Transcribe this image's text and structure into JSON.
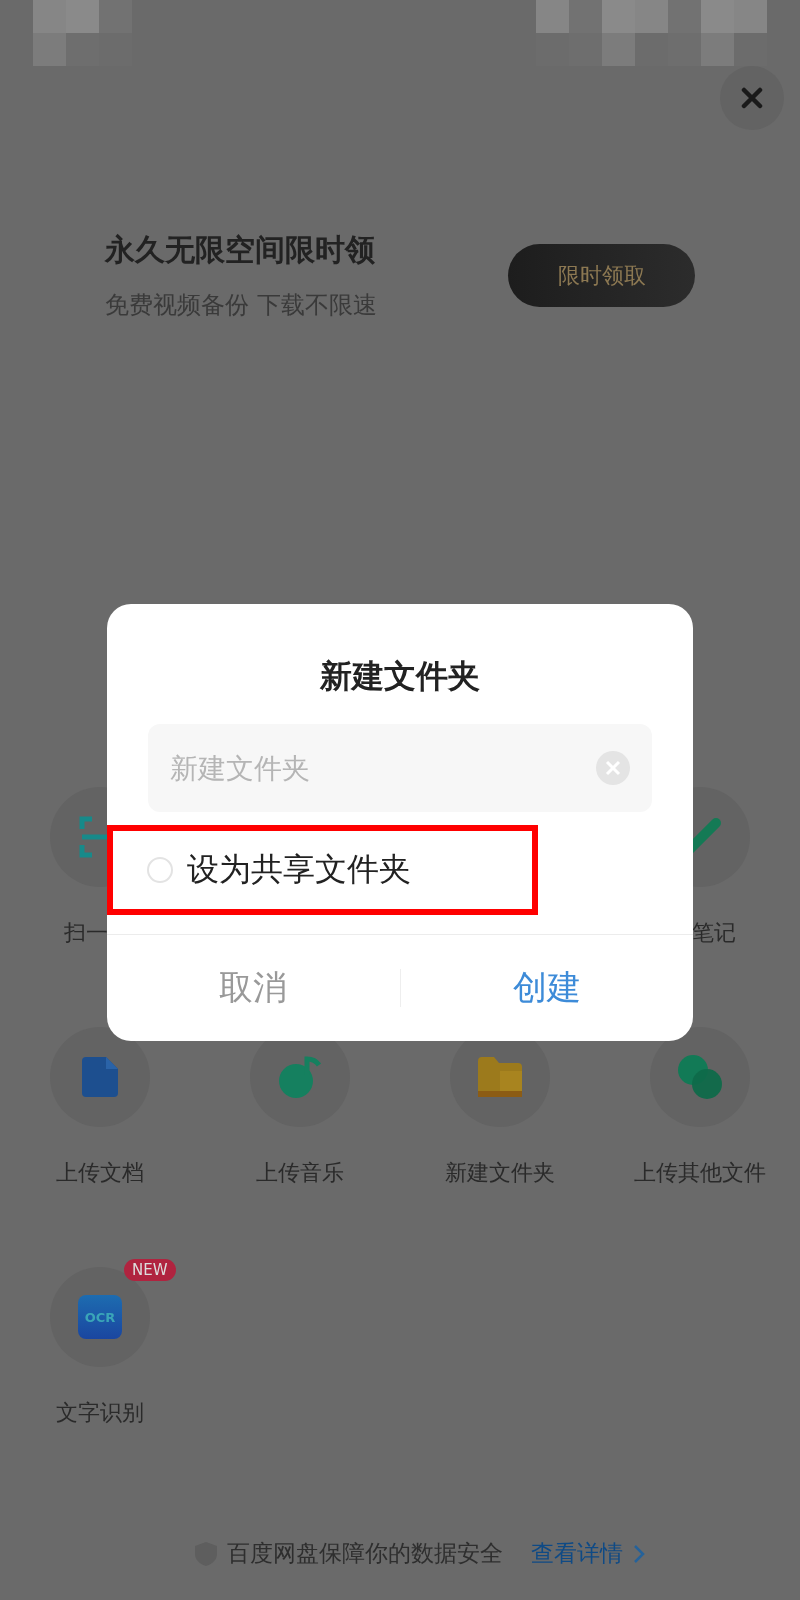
{
  "status_bar": {
    "kind": "pixelated"
  },
  "promo": {
    "title": "永久无限空间限时领",
    "subtitle": "免费视频备份 下载不限速",
    "button": "限时领取"
  },
  "grid": [
    {
      "kind": "scan",
      "label": "扫一"
    },
    {
      "kind": "blank"
    },
    {
      "kind": "blank"
    },
    {
      "kind": "pen",
      "label": "笔记"
    },
    {
      "kind": "doc",
      "label": "上传文档"
    },
    {
      "kind": "music",
      "label": "上传音乐"
    },
    {
      "kind": "folder",
      "label": "新建文件夹"
    },
    {
      "kind": "other",
      "label": "上传其他文件"
    },
    {
      "kind": "ocr",
      "label": "文字识别",
      "icon_text": "OCR",
      "badge": "NEW"
    }
  ],
  "footer": {
    "text": "百度网盘保障你的数据安全",
    "link": "查看详情"
  },
  "dialog": {
    "title": "新建文件夹",
    "field": {
      "placeholder": "新建文件夹"
    },
    "share_option": {
      "label": "设为共享文件夹",
      "checked": false
    },
    "buttons": [
      {
        "label": "取消",
        "kind": "cancel"
      },
      {
        "label": "创建",
        "kind": "primary"
      }
    ]
  },
  "annotation": {
    "kind": "highlight-frame"
  }
}
